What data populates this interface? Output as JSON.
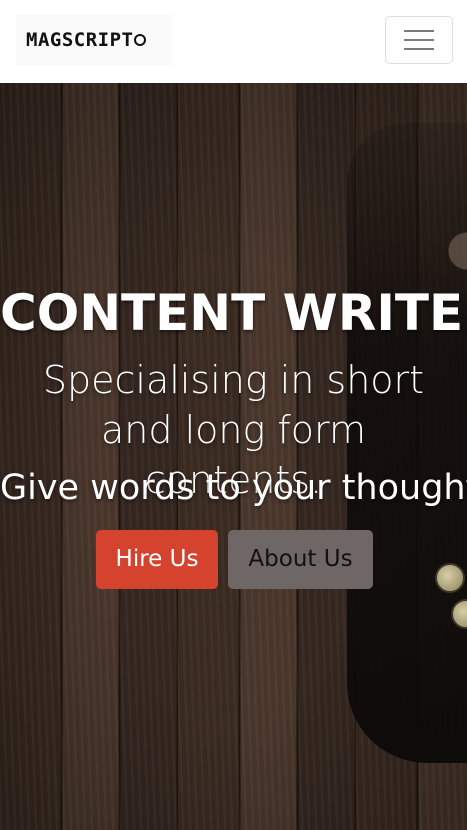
{
  "navbar": {
    "logo_text": "MAGSCRIPT",
    "menu_toggle_icon": "hamburger-menu-icon"
  },
  "hero": {
    "title": "CONTENT WRITER",
    "subtitle": "Specialising in short and long form contents.",
    "tagline": "Give words to your thoughts!",
    "buttons": {
      "hire_label": "Hire Us",
      "about_label": "About Us"
    }
  },
  "colors": {
    "navbar_bg": "#ffffff",
    "hire_button_bg": "#d5432e",
    "about_button_bg": "#6f6766",
    "hero_text": "#ffffff"
  }
}
